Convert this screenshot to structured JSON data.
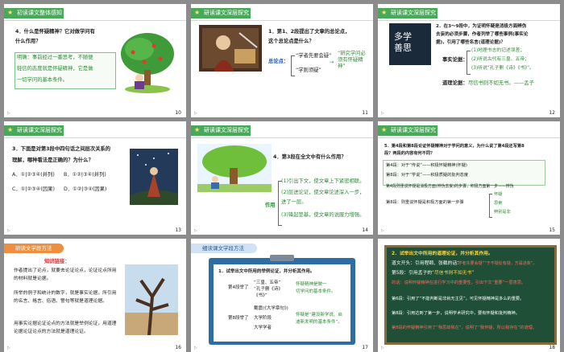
{
  "slides": [
    {
      "number": "10",
      "header": "初读课文整体感知",
      "q1": "4．什么是怀疑精神？它对做学问有",
      "q2": "什么作用？",
      "a1": "明确：事前经过一番思考，不随便",
      "a2": "轻信的态度就是怀疑精神，它是做",
      "a3": "一切学问的基本条件。"
    },
    {
      "number": "11",
      "header": "研读课文深层探究",
      "q1": "1．第1、2段提出了文章的总论点，",
      "q2": "这个总论点是什么？",
      "label": "总论点：",
      "opt1": "“学者先要会疑”",
      "opt2": "“学则须疑”",
      "result": "“研究学问必须有怀疑精神”"
    },
    {
      "number": "12",
      "header": "研读课文深层探究",
      "q1": "2．在3～9段中，为证明怀疑是消极方面辨伪",
      "q2": "去妄的必须步骤，作者列举了哪些事例(事实论",
      "q3": "据)，引用了哪些名言(道理论据)？",
      "label1": "事实论据：",
      "item1": "(1)地理书志的记述误差；",
      "item2": "(2)听说古代有三皇、五帝；",
      "item3": "(3)听说“孔子删《诗》《书》”。",
      "label2": "道理论据：",
      "quote": "尽信书则不如无书。——孟子",
      "calligraphy": "多学善思"
    },
    {
      "number": "13",
      "header": "研读课文深层探究",
      "q1": "3．下面是对第3段中四句话之间层次关系的",
      "q2": "理解，哪种看法是正确的？为什么？",
      "optA": "A．①|②③④(并列)",
      "optB": "B．①②|③④(并列)",
      "optC": "C．①|②③④(因果)",
      "optD": "D．①②|③④(因果)"
    },
    {
      "number": "14",
      "header": "研读课文深层探究",
      "q1": "4．第3段在全文中有什么作用？",
      "label": "作用",
      "item1": "(1)引出下文，使文章上下紧密相联。",
      "item2": "(2)层进论证，使文章论述深入一步，",
      "item3": "进了一层。",
      "item4": "(3)锋起垫基，使文章的说服力增强。"
    },
    {
      "number": "15",
      "header": "研读课文深层探究",
      "q1": "5．第4段和第8段论证怀疑精神对于学问的意义，为什么说了第4段还写第8",
      "q2": "段？两段的内容有何不同？",
      "r1": "第4段：对于“传说”——积极怀疑精神(怀疑)",
      "r2": "第8段：对于“学说”——积极质疑的批判态度",
      "r3": "第4段则重说怀疑是消极方面(辨伪去妄)的步骤，积极方面第一步——辨伪",
      "r4": "第8段：则重说怀疑是积极方面的第一步骤",
      "sub1": "怀疑",
      "sub2": "思索",
      "sub3": "辨别是非"
    },
    {
      "number": "16",
      "header": "研读文学段方法",
      "title": "知识链接：",
      "p1": "作者提出了论点，就要去论证论点，论证论点所用的材料就是论据。",
      "p2": "所举的例子和统计的数字，就是事实论据，所引用的名言、格言、俗语、警句等就是道理论据。",
      "p3": "用事实论据论证论点的方法就是举例论证，用道理论据论证论点的方法就是道理论证。"
    },
    {
      "number": "17",
      "header": "细读课文学段方法",
      "q1": "1．试举出文中所用的举例论证，并分析其作用。",
      "r1": "第4段举了",
      "r1a": "“三皇、五帝”",
      "r1b": "“孔子删《诗》",
      "r1c": "《书》”",
      "r1d": "怀疑精神是做一",
      "r1e": "切学问的基本条件。",
      "r2": "第8段举了",
      "r2a": "戴震(《大学章句》)",
      "r2b": "大学阶段",
      "r2c": "大学学者",
      "r2d": "怀疑是“建设新学说、启",
      "r2e": "迪新发明的基本条件”。"
    },
    {
      "number": "18",
      "q1": "2．试举出文中所用的道理论证，并分析其作用。",
      "l1": "道文开头：引用程颐、张载的话：",
      "l1b": "“学者先要会疑”“于不疑处有疑，方是进矣”。",
      "l2": "第5段：引用孟子的",
      "l2b": "“尽信书则不如无书”",
      "l2c": "的话：说明怀疑精神在进行学习中的重要性，引出下文“重要”一层意思。",
      "l3": "第6段：引用了“不能判断是非就无主见”，可见怀疑精神是多么的重要。",
      "l4": "第8段：引用达到了第一步，说明学术研究中，要有怀疑和批判精神。",
      "l5": "第8段的怀疑精神引用了“我思故我在”，说明了“我怀疑，所以我存在”的道理。"
    }
  ]
}
